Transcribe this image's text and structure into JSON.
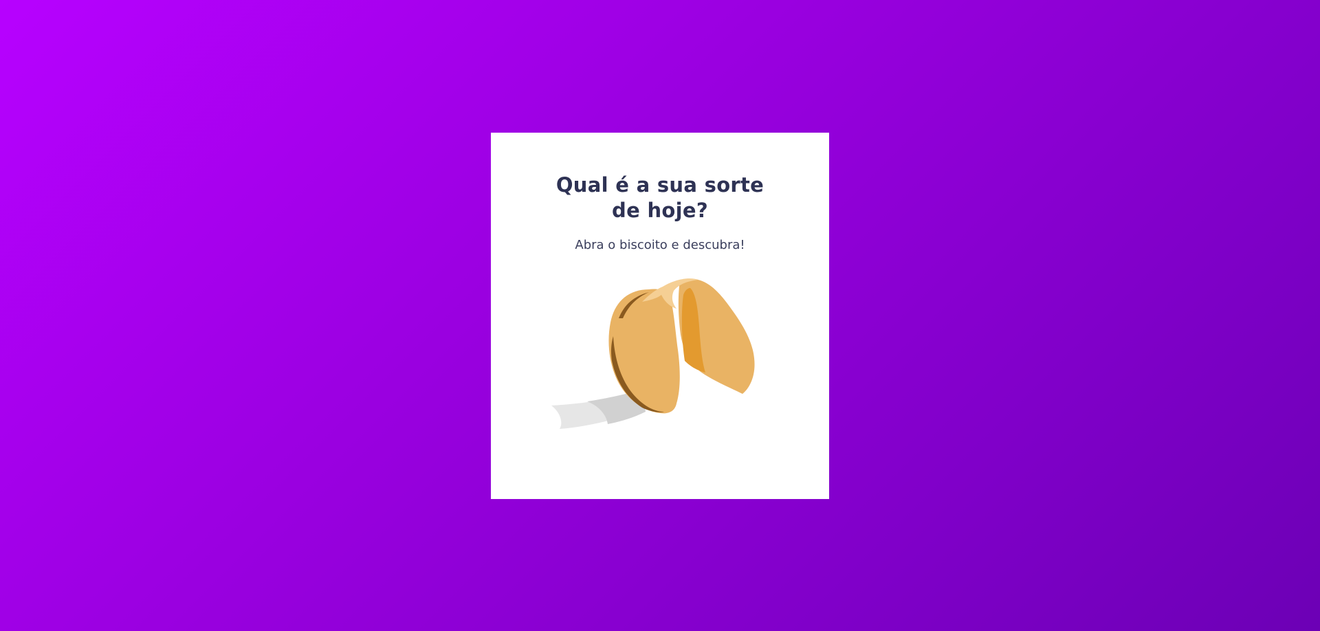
{
  "card": {
    "title_line1": "Qual é a sua sorte",
    "title_line2": "de hoje?",
    "subtitle": "Abra o biscoito e descubra!"
  },
  "cookie": {
    "icon": "fortune-cookie-icon"
  },
  "colors": {
    "background_start": "#b701ff",
    "background_end": "#6c00b5",
    "card": "#ffffff",
    "title": "#2e3254",
    "cookie_body": "#e9b364",
    "cookie_shadow": "#8a5a1f",
    "cookie_inner": "#e39a2f",
    "paper": "#e6e6e6"
  }
}
